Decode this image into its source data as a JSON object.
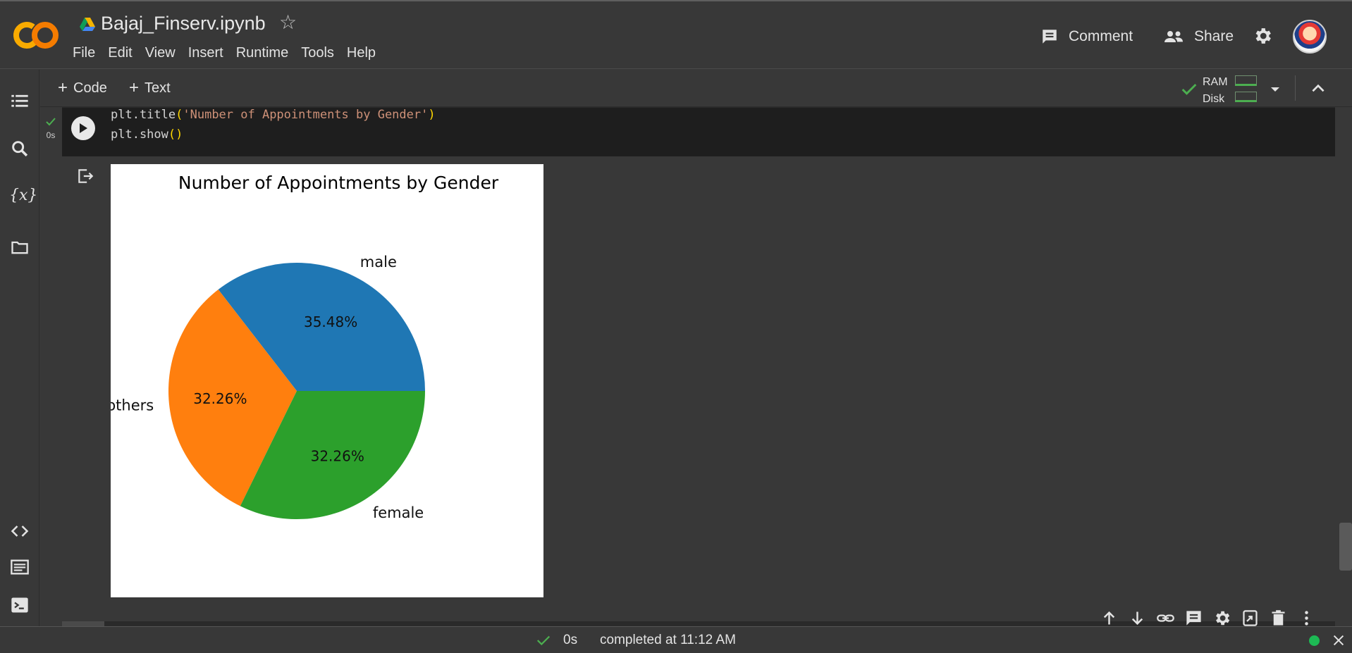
{
  "header": {
    "notebook_title": "Bajaj_Finserv.ipynb",
    "logo_text": "CO",
    "menu": [
      "File",
      "Edit",
      "View",
      "Insert",
      "Runtime",
      "Tools",
      "Help"
    ],
    "comment_label": "Comment",
    "share_label": "Share",
    "icons": [
      "colab-logo",
      "drive-icon",
      "star-icon",
      "comment-icon",
      "share-icon",
      "gear-icon",
      "avatar"
    ]
  },
  "toolbar": {
    "add_code_label": "Code",
    "add_text_label": "Text",
    "ram_label": "RAM",
    "disk_label": "Disk"
  },
  "sidebar": {
    "icons": [
      "toc-icon",
      "search-icon",
      "variables-icon",
      "folder-icon",
      "code-snippets-icon",
      "command-palette-icon",
      "terminal-icon"
    ],
    "variables_glyph": "{x}"
  },
  "cell": {
    "exec_time": "0s",
    "code_lines": [
      {
        "prefix": "plt.title",
        "open": "(",
        "string": "'Number of Appointments by Gender'",
        "close": ")"
      },
      {
        "prefix": "plt.show",
        "open": "(",
        "string": "",
        "close": ")"
      }
    ],
    "tool_icons": [
      "arrow-up-icon",
      "arrow-down-icon",
      "link-icon",
      "comment-icon",
      "gear-icon",
      "mirror-cell-icon",
      "delete-icon",
      "more-vert-icon"
    ]
  },
  "chart_data": {
    "type": "pie",
    "title": "Number of Appointments by Gender",
    "categories": [
      "male",
      "others",
      "female"
    ],
    "values": [
      35.48,
      32.26,
      32.26
    ],
    "labels": [
      "35.48%",
      "32.26%",
      "32.26%"
    ],
    "colors": [
      "#1f77b4",
      "#ff7f0e",
      "#2ca02c"
    ],
    "start_angle": 0,
    "direction": "counterclockwise"
  },
  "status": {
    "time": "0s",
    "message": "completed at 11:12 AM"
  },
  "colors": {
    "background": "#383838",
    "code_bg": "#1e1e1e",
    "accent_green": "#1db954",
    "check_green": "#4caf50"
  }
}
